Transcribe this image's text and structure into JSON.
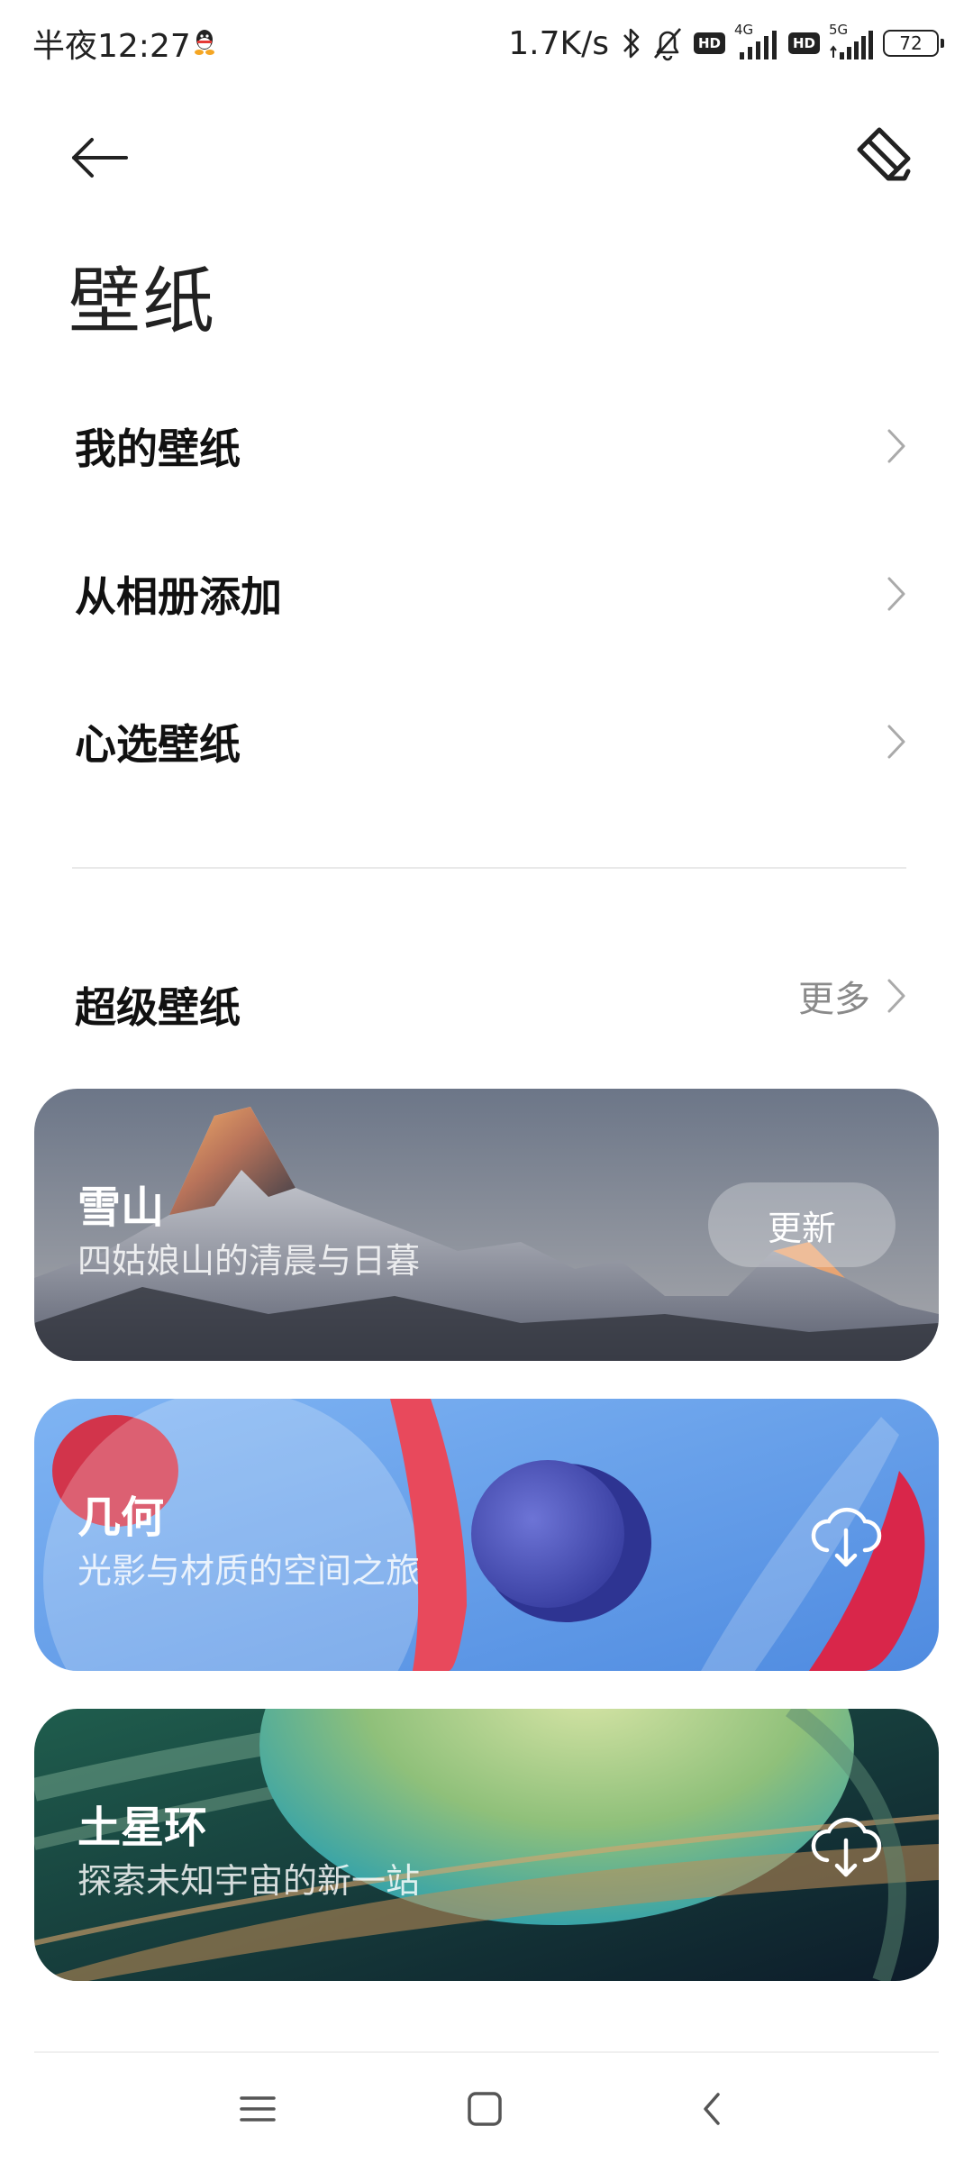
{
  "status_bar": {
    "time": "半夜12:27",
    "net_speed": "1.7K/s",
    "hd1": "HD",
    "sig1_label": "4G",
    "hd2": "HD",
    "sig2_label": "5G",
    "battery": "72"
  },
  "header": {
    "title": "壁纸"
  },
  "menu": [
    {
      "label": "我的壁纸"
    },
    {
      "label": "从相册添加"
    },
    {
      "label": "心选壁纸"
    }
  ],
  "super_section": {
    "title": "超级壁纸",
    "more": "更多"
  },
  "cards": [
    {
      "title": "雪山",
      "subtitle": "四姑娘山的清晨与日暮",
      "action": "更新"
    },
    {
      "title": "几何",
      "subtitle": "光影与材质的空间之旅",
      "action_icon": "cloud-download-icon"
    },
    {
      "title": "土星环",
      "subtitle": "探索未知宇宙的新一站",
      "action_icon": "cloud-download-icon"
    }
  ],
  "nav": [
    "menu-icon",
    "home-icon",
    "back-icon"
  ]
}
